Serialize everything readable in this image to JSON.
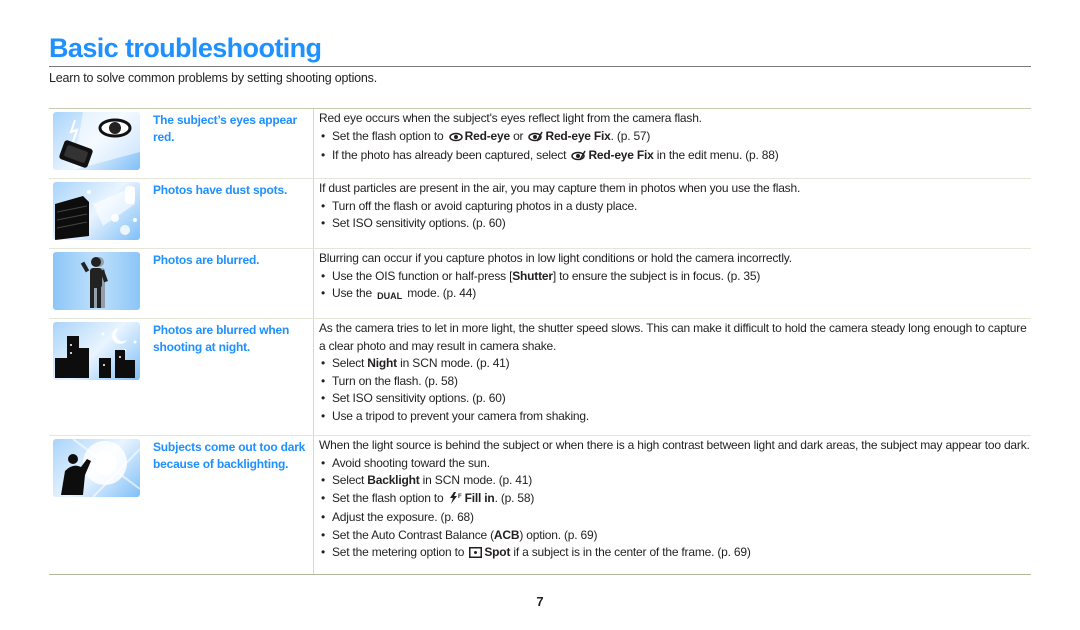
{
  "header": {
    "title": "Basic troubleshooting",
    "intro": "Learn to solve common problems by setting shooting options."
  },
  "rows": [
    {
      "problem": "The subject’s eyes appear red.",
      "image_icon": "red-eye-camera-flash-illustration",
      "lead": "Red eye occurs when the subject's eyes reflect light from the camera flash.",
      "bullets": [
        {
          "pre": "Set the flash option to",
          "icon1": "red-eye-icon",
          "b1": "Red-eye",
          "mid": "or",
          "icon2": "red-eye-fix-icon",
          "b2": "Red-eye Fix",
          "post": ". (p. 57)"
        },
        {
          "pre": "If the photo has already been captured, select",
          "icon1": "red-eye-fix-icon",
          "b1": "Red-eye Fix",
          "post": "in the edit menu. (p. 88)"
        }
      ]
    },
    {
      "problem": "Photos have dust spots.",
      "image_icon": "dust-spots-camera-illustration",
      "lead": "If dust particles are present in the air, you may capture them in photos when you use the flash.",
      "bullets": [
        {
          "text": "Turn off the flash or avoid capturing photos in a dusty place."
        },
        {
          "text": "Set ISO sensitivity options. (p. 60)"
        }
      ]
    },
    {
      "problem": "Photos are blurred.",
      "image_icon": "blurred-person-illustration",
      "lead": "Blurring can occur if you capture photos in low light conditions or hold the camera incorrectly.",
      "bullets": [
        {
          "pre": "Use the OIS function or half-press [",
          "b1": "Shutter",
          "post": "] to ensure the subject is in focus. (p. 35)"
        },
        {
          "pre": "Use the",
          "icon1": "dual-is-mode-icon",
          "icon1_text": "DUAL",
          "post": "mode. (p. 44)"
        }
      ]
    },
    {
      "problem": "Photos are blurred when shooting at night.",
      "image_icon": "night-city-illustration",
      "lead": "As the camera tries to let in more light, the shutter speed slows. This can make it difficult to hold the camera steady long enough to capture a clear photo and may result in camera shake.",
      "bullets": [
        {
          "pre": "Select",
          "b1": "Night",
          "mid": "in",
          "mode": "SCN",
          "post": "mode. (p. 41)"
        },
        {
          "text": "Turn on the flash. (p. 58)"
        },
        {
          "text": "Set ISO sensitivity options. (p. 60)"
        },
        {
          "text": "Use a tripod to prevent your camera from shaking."
        }
      ]
    },
    {
      "problem": "Subjects come out too dark because of backlighting.",
      "image_icon": "backlighting-sun-illustration",
      "lead": "When the light source is behind the subject or when there is a high contrast between light and dark areas, the subject may appear too dark.",
      "bullets": [
        {
          "text": "Avoid shooting toward the sun."
        },
        {
          "pre": "Select",
          "b1": "Backlight",
          "mid": "in",
          "mode": "SCN",
          "post": "mode. (p. 41)"
        },
        {
          "pre": "Set the flash option to",
          "icon1": "fill-in-flash-icon",
          "b1": "Fill in",
          "post": ". (p. 58)"
        },
        {
          "text": "Adjust the exposure. (p. 68)"
        },
        {
          "pre": "Set the Auto Contrast Balance (",
          "b1": "ACB",
          "post": ") option. (p. 69)"
        },
        {
          "pre": "Set the metering option to",
          "icon1": "spot-metering-icon",
          "b1": "Spot",
          "post": "if a subject is in the center of the frame. (p. 69)"
        }
      ]
    }
  ],
  "footer": {
    "page_number": "7"
  },
  "colors": {
    "accent": "#1e90ff",
    "text": "#231f20",
    "rule": "#7a7a7a"
  }
}
